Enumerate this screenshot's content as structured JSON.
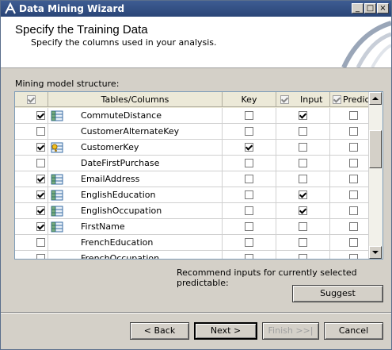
{
  "window": {
    "title": "Data Mining Wizard"
  },
  "header": {
    "title": "Specify the Training Data",
    "subtitle": "Specify the columns used in your analysis."
  },
  "structure_label": "Mining model structure:",
  "columns": {
    "tables_columns": "Tables/Columns",
    "key": "Key",
    "input": "Input",
    "predictable": "Predic..."
  },
  "header_checks": {
    "select_all": true,
    "input": true,
    "predictable": true
  },
  "rows": [
    {
      "name": "CommuteDistance",
      "selected": true,
      "icon": "column-icon",
      "key": false,
      "input": true,
      "predictable": false
    },
    {
      "name": "CustomerAlternateKey",
      "selected": false,
      "icon": "",
      "key": false,
      "input": false,
      "predictable": false
    },
    {
      "name": "CustomerKey",
      "selected": true,
      "icon": "key-column-icon",
      "key": true,
      "input": false,
      "predictable": false
    },
    {
      "name": "DateFirstPurchase",
      "selected": false,
      "icon": "",
      "key": false,
      "input": false,
      "predictable": false
    },
    {
      "name": "EmailAddress",
      "selected": true,
      "icon": "column-icon",
      "key": false,
      "input": false,
      "predictable": false
    },
    {
      "name": "EnglishEducation",
      "selected": true,
      "icon": "column-icon",
      "key": false,
      "input": true,
      "predictable": false
    },
    {
      "name": "EnglishOccupation",
      "selected": true,
      "icon": "column-icon",
      "key": false,
      "input": true,
      "predictable": false
    },
    {
      "name": "FirstName",
      "selected": true,
      "icon": "column-icon",
      "key": false,
      "input": false,
      "predictable": false
    },
    {
      "name": "FrenchEducation",
      "selected": false,
      "icon": "",
      "key": false,
      "input": false,
      "predictable": false
    },
    {
      "name": "FrenchOccupation",
      "selected": false,
      "icon": "",
      "key": false,
      "input": false,
      "predictable": false
    }
  ],
  "recommend_text": "Recommend inputs for currently selected predictable:",
  "buttons": {
    "suggest": "Suggest",
    "back": "< Back",
    "next": "Next >",
    "finish": "Finish >>|",
    "cancel": "Cancel"
  },
  "colors": {
    "title_bar": "#2a4577",
    "face": "#d4d0c8"
  }
}
